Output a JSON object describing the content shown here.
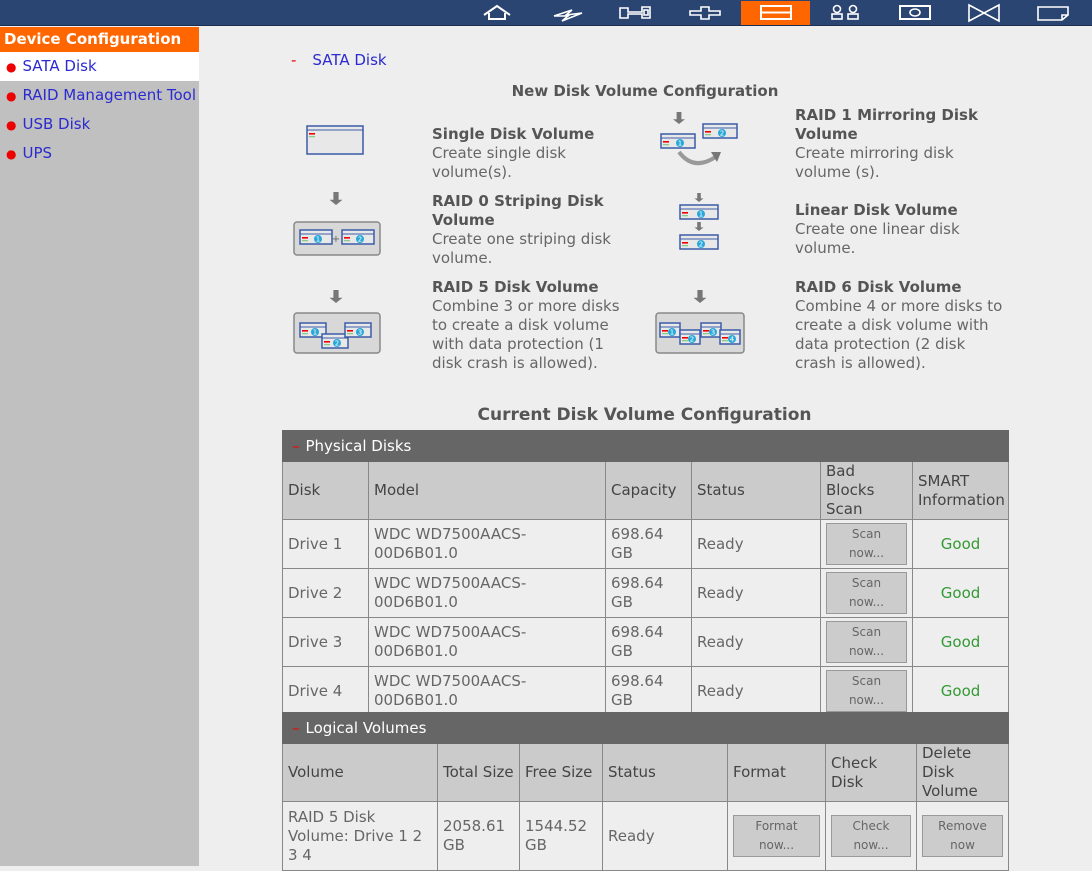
{
  "nav": {
    "icons": [
      "home-icon",
      "power-icon",
      "network-icon",
      "services-icon",
      "disk-icon",
      "users-icon",
      "backup-icon",
      "share-icon",
      "system-icon"
    ],
    "active_index": 4,
    "accent": "#ff6600",
    "bar_color": "#2a4571"
  },
  "sidebar": {
    "title": "Device Configuration",
    "items": [
      {
        "label": "SATA Disk"
      },
      {
        "label": "RAID Management Tool"
      },
      {
        "label": "USB Disk"
      },
      {
        "label": "UPS"
      }
    ]
  },
  "breadcrumb": {
    "dash": "-",
    "label": "SATA Disk"
  },
  "new_config": {
    "title": "New Disk Volume Configuration",
    "options": [
      {
        "title": "Single Disk Volume",
        "desc": "Create single disk volume(s)."
      },
      {
        "title": "RAID 1 Mirroring Disk Volume",
        "desc": "Create mirroring disk volume (s)."
      },
      {
        "title": "RAID 0 Striping Disk Volume",
        "desc": "Create one striping disk volume."
      },
      {
        "title": "Linear Disk Volume",
        "desc": "Create one linear disk volume."
      },
      {
        "title": "RAID 5 Disk Volume",
        "desc": "Combine 3 or more disks to create a disk volume with data protection (1 disk crash is allowed)."
      },
      {
        "title": "RAID 6 Disk Volume",
        "desc": "Combine 4 or more disks to create a disk volume with data protection (2 disk crash is allowed)."
      }
    ]
  },
  "current_config": {
    "title": "Current Disk Volume Configuration",
    "physical": {
      "title": "Physical Disks",
      "headers": [
        "Disk",
        "Model",
        "Capacity",
        "Status",
        "Bad Blocks Scan",
        "SMART Information"
      ],
      "rows": [
        {
          "disk": "Drive 1",
          "model": "WDC WD7500AACS-00D6B01.0",
          "capacity": "698.64 GB",
          "status": "Ready",
          "scan": "Scan now...",
          "smart": "Good"
        },
        {
          "disk": "Drive 2",
          "model": "WDC WD7500AACS-00D6B01.0",
          "capacity": "698.64 GB",
          "status": "Ready",
          "scan": "Scan now...",
          "smart": "Good"
        },
        {
          "disk": "Drive 3",
          "model": "WDC WD7500AACS-00D6B01.0",
          "capacity": "698.64 GB",
          "status": "Ready",
          "scan": "Scan now...",
          "smart": "Good"
        },
        {
          "disk": "Drive 4",
          "model": "WDC WD7500AACS-00D6B01.0",
          "capacity": "698.64 GB",
          "status": "Ready",
          "scan": "Scan now...",
          "smart": "Good"
        }
      ]
    },
    "logical": {
      "title": "Logical Volumes",
      "headers": [
        "Volume",
        "Total Size",
        "Free Size",
        "Status",
        "Format",
        "Check Disk",
        "Delete Disk Volume"
      ],
      "rows": [
        {
          "volume": "RAID 5 Disk Volume: Drive 1 2 3 4",
          "total": "2058.61 GB",
          "free": "1544.52 GB",
          "status": "Ready",
          "format": "Format now...",
          "check": "Check now...",
          "remove": "Remove now"
        }
      ]
    }
  }
}
